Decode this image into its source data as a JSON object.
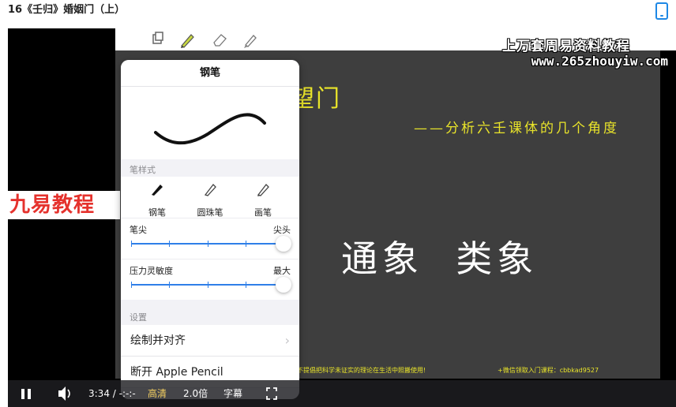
{
  "page": {
    "title": "16《壬归》婚姻门（上）"
  },
  "toolbar_icons": [
    "layers-icon",
    "pen-icon",
    "eraser-icon",
    "marker-icon"
  ],
  "watermarks": {
    "line1": "上万套周易资料教程",
    "line2": "www.265zhouyiw.com",
    "left_badge": "九易教程"
  },
  "slide": {
    "title_fragment": "望门",
    "subtitle": "——分析六壬课体的几个角度",
    "main_text": "通象  类象",
    "footer_left": "不提倡把科学未证实的理论在生活中照搬使用!",
    "footer_right": "+微信领取入门课程：cbbkad9527"
  },
  "popover": {
    "title": "钢笔",
    "style_section": "笔样式",
    "styles": [
      {
        "label": "钢笔",
        "selected": true
      },
      {
        "label": "圆珠笔",
        "selected": false
      },
      {
        "label": "画笔",
        "selected": false
      }
    ],
    "tip": {
      "left": "笔尖",
      "right": "尖头",
      "value_percent": 100
    },
    "pressure": {
      "left": "压力灵敏度",
      "right": "最大",
      "value_percent": 100
    },
    "settings_section": "设置",
    "menu": [
      {
        "label": "绘制并对齐",
        "chevron": true
      },
      {
        "label": "断开 Apple Pencil",
        "chevron": false
      }
    ]
  },
  "player": {
    "time": "3:34 / -:-:-",
    "quality": "高清",
    "speed": "2.0倍",
    "subtitles": "字幕",
    "accent_color": "#f5d060"
  }
}
